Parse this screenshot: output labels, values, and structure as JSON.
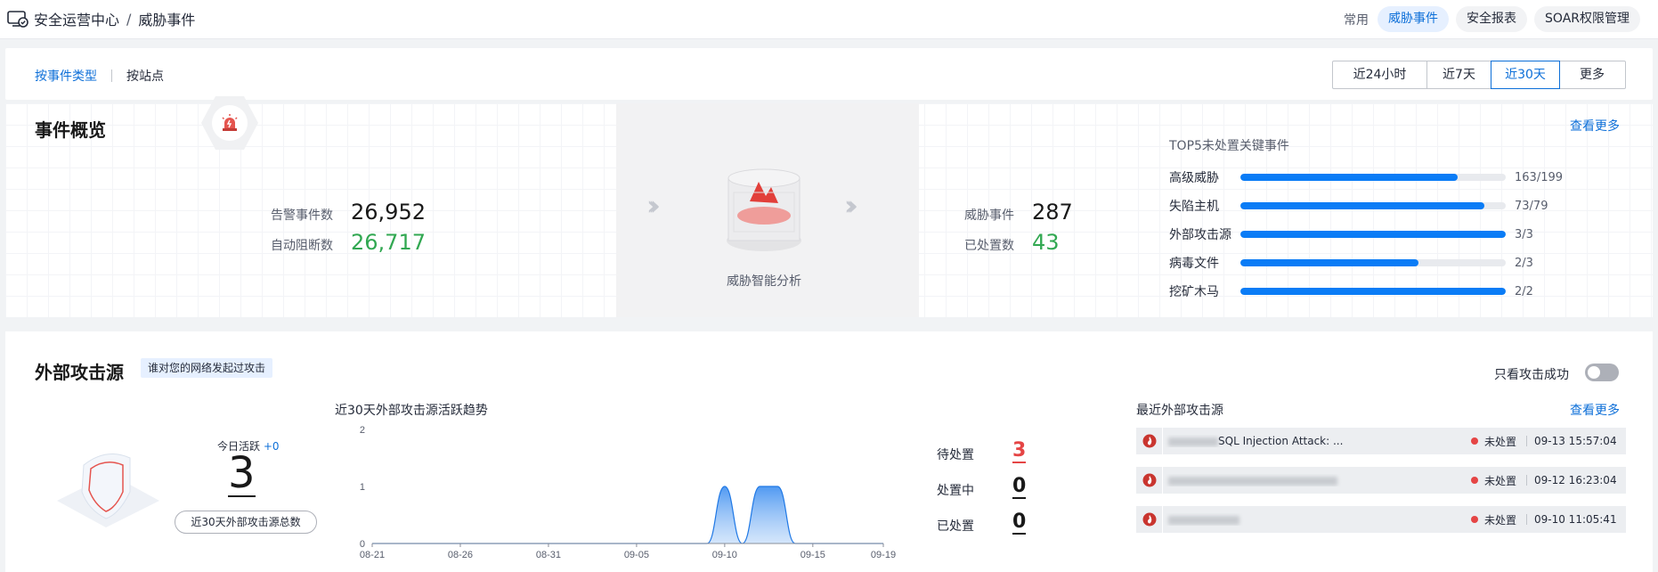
{
  "breadcrumb": {
    "root": "安全运营中心",
    "separator": "/",
    "current": "威胁事件"
  },
  "quick_links": {
    "label": "常用",
    "items": [
      "威胁事件",
      "安全报表",
      "SOAR权限管理"
    ],
    "active_index": 0
  },
  "view_tabs": {
    "items": [
      "按事件类型",
      "按站点"
    ],
    "active_index": 0
  },
  "time_range": {
    "items": [
      "近24小时",
      "近7天",
      "近30天",
      "更多"
    ],
    "active_index": 2
  },
  "overview": {
    "title": "事件概览",
    "alert_label": "告警事件数",
    "alert_value": "26,952",
    "blocked_label": "自动阻断数",
    "blocked_value": "26,717",
    "analysis_label": "威胁智能分析",
    "threat_label": "威胁事件",
    "threat_value": "287",
    "handled_label": "已处置数",
    "handled_value": "43",
    "more_link": "查看更多",
    "top5_title": "TOP5未处置关键事件",
    "top5": [
      {
        "name": "高级威胁",
        "value": "163/199",
        "fraction": 0.82
      },
      {
        "name": "失陷主机",
        "value": "73/79",
        "fraction": 0.92
      },
      {
        "name": "外部攻击源",
        "value": "3/3",
        "fraction": 1.0
      },
      {
        "name": "病毒文件",
        "value": "2/3",
        "fraction": 0.67
      },
      {
        "name": "挖矿木马",
        "value": "2/2",
        "fraction": 1.0
      }
    ]
  },
  "external": {
    "title": "外部攻击源",
    "tag": "谁对您的网络发起过攻击",
    "switch_label": "只看攻击成功",
    "switch_on": false,
    "today_label": "今日活跃",
    "today_delta": "+0",
    "today_value": "3",
    "total_button": "近30天外部攻击源总数",
    "chart_title": "近30天外部攻击源活跃趋势",
    "pending_label": "待处置",
    "pending_value": "3",
    "processing_label": "处置中",
    "processing_value": "0",
    "done_label": "已处置",
    "done_value": "0",
    "recent_title": "最近外部攻击源",
    "recent_more": "查看更多",
    "recent": [
      {
        "text": "SQL Injection Attack: ...",
        "status": "未处置",
        "time": "09-13 15:57:04"
      },
      {
        "text": "",
        "status": "未处置",
        "time": "09-12 16:23:04"
      },
      {
        "text": "",
        "status": "未处置",
        "time": "09-10 11:05:41"
      }
    ]
  },
  "chart_data": {
    "type": "area",
    "title": "近30天外部攻击源活跃趋势",
    "x_ticks": [
      "08-21",
      "08-26",
      "08-31",
      "09-05",
      "09-10",
      "09-15",
      "09-19"
    ],
    "x": [
      "08-21",
      "08-22",
      "08-23",
      "08-24",
      "08-25",
      "08-26",
      "08-27",
      "08-28",
      "08-29",
      "08-30",
      "08-31",
      "09-01",
      "09-02",
      "09-03",
      "09-04",
      "09-05",
      "09-06",
      "09-07",
      "09-08",
      "09-09",
      "09-10",
      "09-11",
      "09-12",
      "09-13",
      "09-14",
      "09-15",
      "09-16",
      "09-17",
      "09-18",
      "09-19"
    ],
    "values": [
      0,
      0,
      0,
      0,
      0,
      0,
      0,
      0,
      0,
      0,
      0,
      0,
      0,
      0,
      0,
      0,
      0,
      0,
      0,
      0,
      1,
      0,
      1,
      1,
      0,
      0,
      0,
      0,
      0,
      0
    ],
    "y_ticks": [
      "0",
      "1",
      "2"
    ],
    "ylim": [
      0,
      2
    ]
  }
}
